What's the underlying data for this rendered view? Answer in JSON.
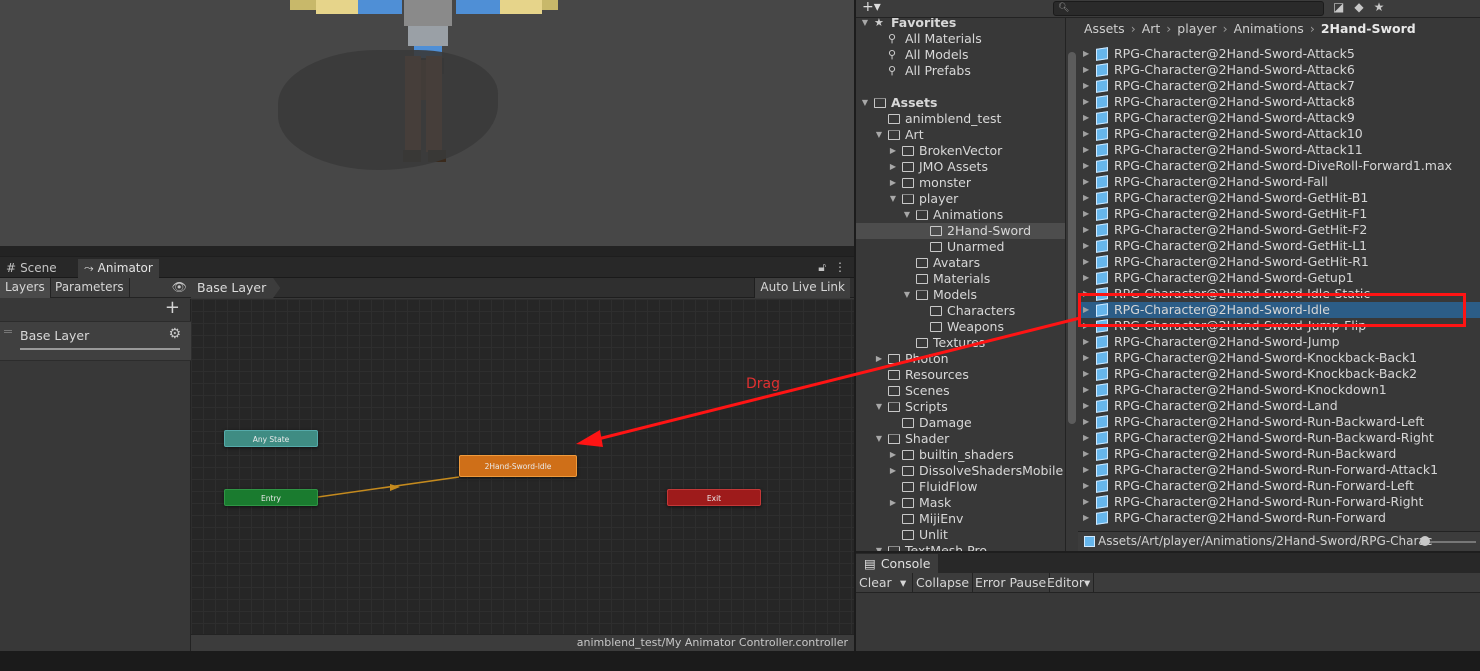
{
  "scene": {
    "tab_label": "Scene"
  },
  "animator": {
    "tab_label": "Animator",
    "layers_label": "Layers",
    "parameters_label": "Parameters",
    "layer_name": "Base Layer",
    "breadcrumb": "Base Layer",
    "auto_live_link": "Auto Live Link",
    "states": {
      "any_state": "Any State",
      "idle": "2Hand-Sword-Idle",
      "entry": "Entry",
      "exit": "Exit"
    },
    "controller_path": "animblend_test/My Animator Controller.controller"
  },
  "annotation": {
    "drag_label": "Drag",
    "color": "#ff1414"
  },
  "project": {
    "search_placeholder": "",
    "tree": [
      {
        "label": "Favorites",
        "depth": 0,
        "arrow": "down",
        "icon": "star",
        "bold": true
      },
      {
        "label": "All Materials",
        "depth": 1,
        "icon": "search"
      },
      {
        "label": "All Models",
        "depth": 1,
        "icon": "search"
      },
      {
        "label": "All Prefabs",
        "depth": 1,
        "icon": "search"
      },
      {
        "label": "",
        "depth": 0,
        "icon": "none"
      },
      {
        "label": "Assets",
        "depth": 0,
        "arrow": "down",
        "icon": "folder-open",
        "bold": true
      },
      {
        "label": "animblend_test",
        "depth": 1,
        "icon": "folder"
      },
      {
        "label": "Art",
        "depth": 1,
        "arrow": "down",
        "icon": "folder-open"
      },
      {
        "label": "BrokenVector",
        "depth": 2,
        "arrow": "right",
        "icon": "folder"
      },
      {
        "label": "JMO Assets",
        "depth": 2,
        "arrow": "right",
        "icon": "folder"
      },
      {
        "label": "monster",
        "depth": 2,
        "arrow": "right",
        "icon": "folder"
      },
      {
        "label": "player",
        "depth": 2,
        "arrow": "down",
        "icon": "folder-open"
      },
      {
        "label": "Animations",
        "depth": 3,
        "arrow": "down",
        "icon": "folder-open"
      },
      {
        "label": "2Hand-Sword",
        "depth": 4,
        "icon": "folder",
        "selected": true
      },
      {
        "label": "Unarmed",
        "depth": 4,
        "icon": "folder"
      },
      {
        "label": "Avatars",
        "depth": 3,
        "icon": "folder"
      },
      {
        "label": "Materials",
        "depth": 3,
        "icon": "folder"
      },
      {
        "label": "Models",
        "depth": 3,
        "arrow": "down",
        "icon": "folder-open"
      },
      {
        "label": "Characters",
        "depth": 4,
        "icon": "folder"
      },
      {
        "label": "Weapons",
        "depth": 4,
        "icon": "folder"
      },
      {
        "label": "Textures",
        "depth": 3,
        "icon": "folder"
      },
      {
        "label": "Photon",
        "depth": 1,
        "arrow": "right",
        "icon": "folder"
      },
      {
        "label": "Resources",
        "depth": 1,
        "icon": "folder"
      },
      {
        "label": "Scenes",
        "depth": 1,
        "icon": "folder"
      },
      {
        "label": "Scripts",
        "depth": 1,
        "arrow": "down",
        "icon": "folder-open"
      },
      {
        "label": "Damage",
        "depth": 2,
        "icon": "folder"
      },
      {
        "label": "Shader",
        "depth": 1,
        "arrow": "down",
        "icon": "folder-open"
      },
      {
        "label": "builtin_shaders",
        "depth": 2,
        "arrow": "right",
        "icon": "folder"
      },
      {
        "label": "DissolveShadersMobile",
        "depth": 2,
        "arrow": "right",
        "icon": "folder"
      },
      {
        "label": "FluidFlow",
        "depth": 2,
        "icon": "folder"
      },
      {
        "label": "Mask",
        "depth": 2,
        "arrow": "right",
        "icon": "folder"
      },
      {
        "label": "MijiEnv",
        "depth": 2,
        "icon": "folder"
      },
      {
        "label": "Unlit",
        "depth": 2,
        "icon": "folder"
      },
      {
        "label": "TextMesh Pro",
        "depth": 1,
        "arrow": "down",
        "icon": "folder-open"
      }
    ],
    "breadcrumbs": [
      "Assets",
      "Art",
      "player",
      "Animations",
      "2Hand-Sword"
    ],
    "files": [
      "RPG-Character@2Hand-Sword-Attack5",
      "RPG-Character@2Hand-Sword-Attack6",
      "RPG-Character@2Hand-Sword-Attack7",
      "RPG-Character@2Hand-Sword-Attack8",
      "RPG-Character@2Hand-Sword-Attack9",
      "RPG-Character@2Hand-Sword-Attack10",
      "RPG-Character@2Hand-Sword-Attack11",
      "RPG-Character@2Hand-Sword-DiveRoll-Forward1.max",
      "RPG-Character@2Hand-Sword-Fall",
      "RPG-Character@2Hand-Sword-GetHit-B1",
      "RPG-Character@2Hand-Sword-GetHit-F1",
      "RPG-Character@2Hand-Sword-GetHit-F2",
      "RPG-Character@2Hand-Sword-GetHit-L1",
      "RPG-Character@2Hand-Sword-GetHit-R1",
      "RPG-Character@2Hand-Sword-Getup1",
      "RPG-Character@2Hand-Sword-Idle-Static",
      "RPG-Character@2Hand-Sword-Idle",
      "RPG-Character@2Hand-Sword-Jump-Flip",
      "RPG-Character@2Hand-Sword-Jump",
      "RPG-Character@2Hand-Sword-Knockback-Back1",
      "RPG-Character@2Hand-Sword-Knockback-Back2",
      "RPG-Character@2Hand-Sword-Knockdown1",
      "RPG-Character@2Hand-Sword-Land",
      "RPG-Character@2Hand-Sword-Run-Backward-Left",
      "RPG-Character@2Hand-Sword-Run-Backward-Right",
      "RPG-Character@2Hand-Sword-Run-Backward",
      "RPG-Character@2Hand-Sword-Run-Forward-Attack1",
      "RPG-Character@2Hand-Sword-Run-Forward-Left",
      "RPG-Character@2Hand-Sword-Run-Forward-Right",
      "RPG-Character@2Hand-Sword-Run-Forward"
    ],
    "selected_file_index": 16,
    "asset_path": "Assets/Art/player/Animations/2Hand-Sword/RPG-Charac"
  },
  "console": {
    "tab_label": "Console",
    "clear": "Clear",
    "collapse": "Collapse",
    "error_pause": "Error Pause",
    "editor": "Editor"
  },
  "colors": {
    "any_state": "#3f8c83",
    "idle_state": "#cf6f18",
    "entry_state": "#1a7b2f",
    "exit_state": "#9e1b1b",
    "selection": "#2c5d87"
  }
}
